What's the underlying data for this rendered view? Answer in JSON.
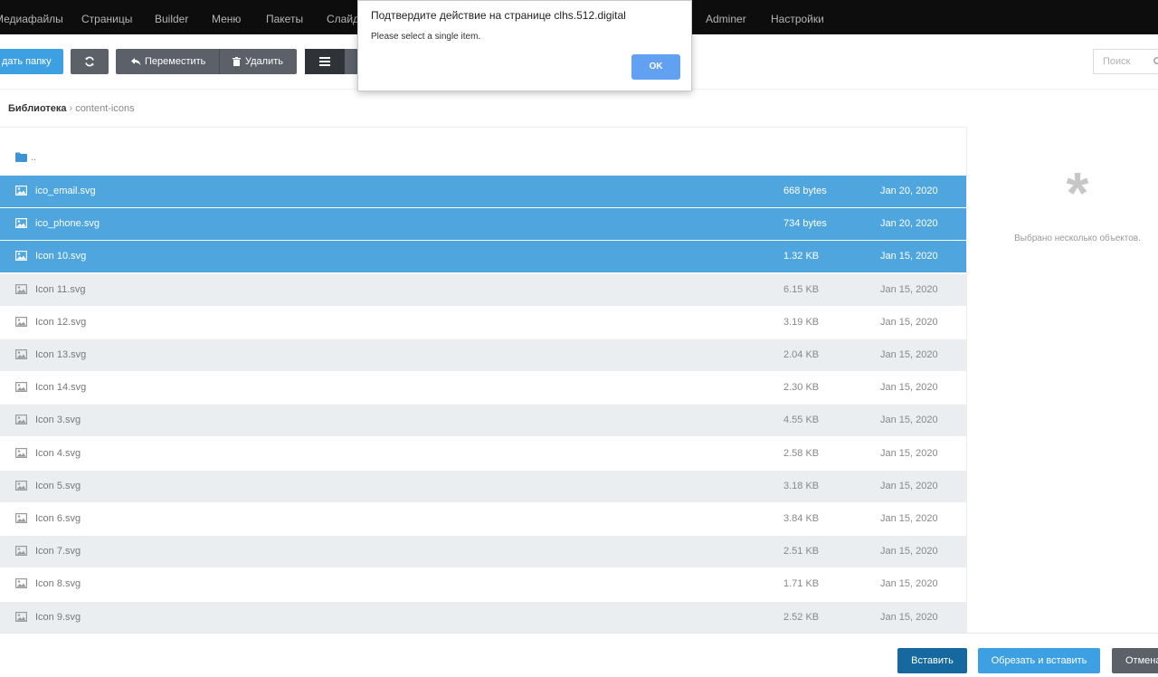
{
  "nav": {
    "items": [
      "Медиафайлы",
      "Страницы",
      "Builder",
      "Меню",
      "Пакеты",
      "Слайде",
      "Adminer",
      "Настройки"
    ]
  },
  "toolbar": {
    "create_folder_label": "дать папку",
    "move_label": "Переместить",
    "delete_label": "Удалить",
    "search_placeholder": "Поиск"
  },
  "breadcrumb": {
    "root": "Библиотека",
    "separator": "›",
    "current": "content-icons"
  },
  "files": {
    "parent_label": "..",
    "items": [
      {
        "name": "ico_email.svg",
        "size": "668 bytes",
        "date": "Jan 20, 2020",
        "selected": true
      },
      {
        "name": "ico_phone.svg",
        "size": "734 bytes",
        "date": "Jan 20, 2020",
        "selected": true
      },
      {
        "name": "Icon 10.svg",
        "size": "1.32 KB",
        "date": "Jan 15, 2020",
        "selected": true
      },
      {
        "name": "Icon 11.svg",
        "size": "6.15 KB",
        "date": "Jan 15, 2020",
        "selected": false
      },
      {
        "name": "Icon 12.svg",
        "size": "3.19 KB",
        "date": "Jan 15, 2020",
        "selected": false
      },
      {
        "name": "Icon 13.svg",
        "size": "2.04 KB",
        "date": "Jan 15, 2020",
        "selected": false
      },
      {
        "name": "Icon 14.svg",
        "size": "2.30 KB",
        "date": "Jan 15, 2020",
        "selected": false
      },
      {
        "name": "Icon 3.svg",
        "size": "4.55 KB",
        "date": "Jan 15, 2020",
        "selected": false
      },
      {
        "name": "Icon 4.svg",
        "size": "2.58 KB",
        "date": "Jan 15, 2020",
        "selected": false
      },
      {
        "name": "Icon 5.svg",
        "size": "3.18 KB",
        "date": "Jan 15, 2020",
        "selected": false
      },
      {
        "name": "Icon 6.svg",
        "size": "3.84 KB",
        "date": "Jan 15, 2020",
        "selected": false
      },
      {
        "name": "Icon 7.svg",
        "size": "2.51 KB",
        "date": "Jan 15, 2020",
        "selected": false
      },
      {
        "name": "Icon 8.svg",
        "size": "1.71 KB",
        "date": "Jan 15, 2020",
        "selected": false
      },
      {
        "name": "Icon 9.svg",
        "size": "2.52 KB",
        "date": "Jan 15, 2020",
        "selected": false
      }
    ]
  },
  "side_panel": {
    "message": "Выбрано несколько объектов."
  },
  "footer": {
    "insert_label": "Вставить",
    "cut_insert_label": "Обрезать и вставить",
    "cancel_label": "Отмена"
  },
  "dialog": {
    "title": "Подтвердите действие на странице clhs.512.digital",
    "message": "Please select a single item.",
    "ok_label": "OK"
  },
  "colors": {
    "selection": "#4fa6df",
    "primary": "#3da0e3",
    "dark_button": "#5b6069",
    "nav_bg": "#0d0d0d"
  }
}
